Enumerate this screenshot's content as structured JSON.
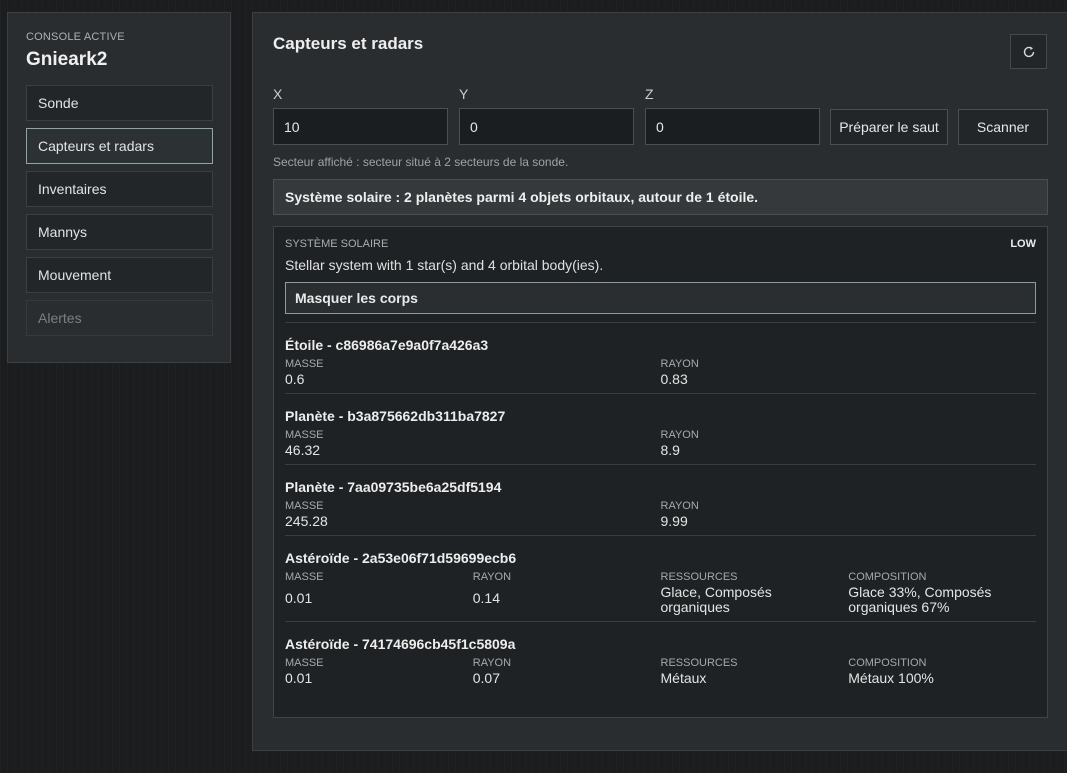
{
  "sidebar": {
    "console_label": "CONSOLE ACTIVE",
    "console_name": "Gnieark2",
    "items": [
      {
        "label": "Sonde"
      },
      {
        "label": "Capteurs et radars"
      },
      {
        "label": "Inventaires"
      },
      {
        "label": "Mannys"
      },
      {
        "label": "Mouvement"
      },
      {
        "label": "Alertes"
      }
    ]
  },
  "main": {
    "title": "Capteurs et radars",
    "refresh_icon": "refresh-icon",
    "coords": {
      "x_label": "X",
      "x_value": "10",
      "y_label": "Y",
      "y_value": "0",
      "z_label": "Z",
      "z_value": "0"
    },
    "prepare_jump_label": "Préparer le saut",
    "scan_label": "Scanner",
    "sector_note": "Secteur affiché : secteur situé à 2 secteurs de la sonde.",
    "summary": "Système solaire : 2 planètes parmi 4 objets orbitaux, autour de 1 étoile."
  },
  "system": {
    "label": "SYSTÈME SOLAIRE",
    "level": "LOW",
    "description": "Stellar system with 1 star(s) and 4 orbital body(ies).",
    "toggle_label": "Masquer les corps",
    "bodies": [
      {
        "title": "Étoile - c86986a7e9a0f7a426a3",
        "mass_label": "MASSE",
        "mass": "0.6",
        "radius_label": "RAYON",
        "radius": "0.83"
      },
      {
        "title": "Planète - b3a875662db311ba7827",
        "mass_label": "MASSE",
        "mass": "46.32",
        "radius_label": "RAYON",
        "radius": "8.9"
      },
      {
        "title": "Planète - 7aa09735be6a25df5194",
        "mass_label": "MASSE",
        "mass": "245.28",
        "radius_label": "RAYON",
        "radius": "9.99"
      },
      {
        "title": "Astéroïde - 2a53e06f71d59699ecb6",
        "mass_label": "MASSE",
        "mass": "0.01",
        "radius_label": "RAYON",
        "radius": "0.14",
        "resources_label": "RESSOURCES",
        "resources_line1": "Glace, Composés",
        "resources_line2": "organiques",
        "composition_label": "COMPOSITION",
        "composition_line1": "Glace 33%, Composés",
        "composition_line2": "organiques 67%"
      },
      {
        "title": "Astéroïde - 74174696cb45f1c5809a",
        "mass_label": "MASSE",
        "mass": "0.01",
        "radius_label": "RAYON",
        "radius": "0.07",
        "resources_label": "RESSOURCES",
        "resources_line1": "Métaux",
        "composition_label": "COMPOSITION",
        "composition_line1": "Métaux 100%"
      }
    ]
  }
}
